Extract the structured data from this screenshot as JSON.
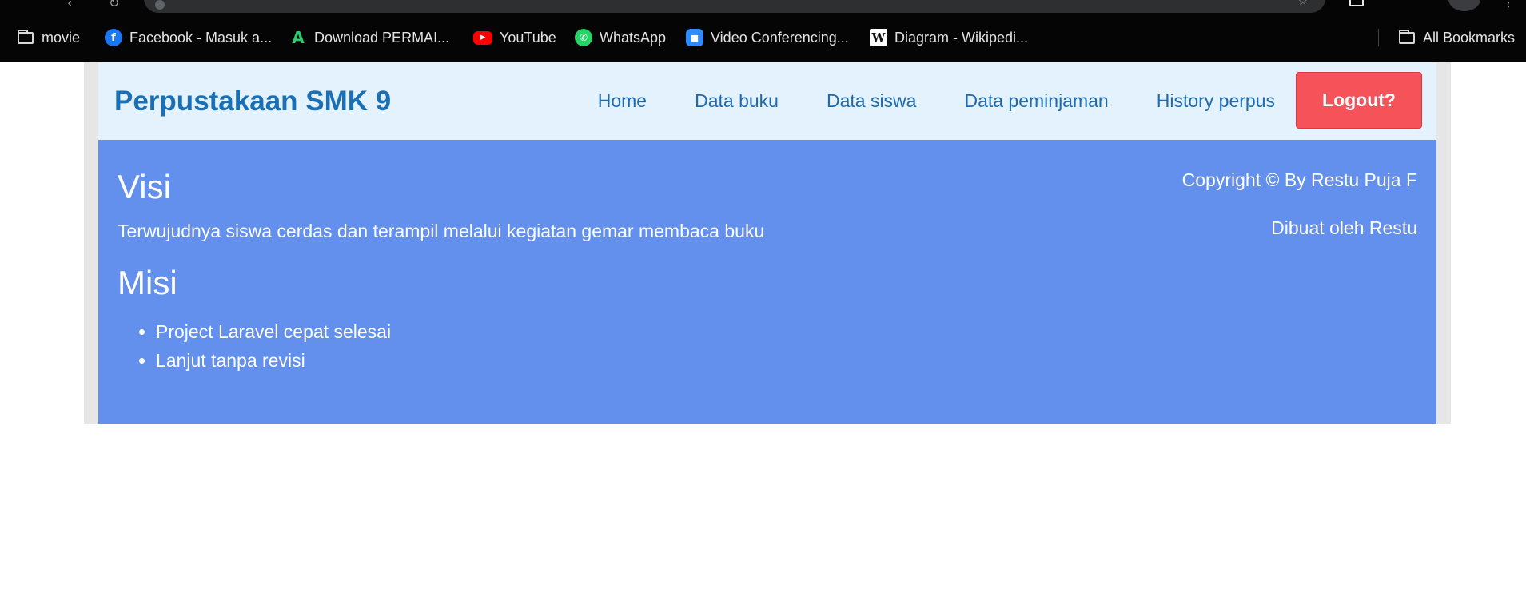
{
  "browser": {
    "bookmarks": [
      {
        "label": "movie",
        "icon": "folder-icon"
      },
      {
        "label": "Facebook - Masuk a...",
        "icon": "facebook-icon"
      },
      {
        "label": "Download PERMAI...",
        "icon": "apk-download-icon"
      },
      {
        "label": "YouTube",
        "icon": "youtube-icon"
      },
      {
        "label": "WhatsApp",
        "icon": "whatsapp-icon"
      },
      {
        "label": "Video Conferencing...",
        "icon": "zoom-icon"
      },
      {
        "label": "Diagram - Wikipedi...",
        "icon": "wikipedia-icon"
      }
    ],
    "all_bookmarks": "All Bookmarks"
  },
  "navbar": {
    "brand": "Perpustakaan SMK 9",
    "links": [
      "Home",
      "Data buku",
      "Data siswa",
      "Data peminjaman",
      "History perpus"
    ],
    "logout_label": "Logout?"
  },
  "content": {
    "visi_title": "Visi",
    "visi_text": "Terwujudnya siswa cerdas dan terampil melalui kegiatan gemar membaca buku",
    "misi_title": "Misi",
    "misi_items": [
      "Project Laravel cepat selesai",
      "Lanjut tanpa revisi"
    ],
    "copyright": "Copyright © By Restu Puja F",
    "credit": "Dibuat oleh Restu"
  },
  "colors": {
    "navbar_bg": "#e3f2fc",
    "brand": "#1a6fb5",
    "content_bg": "#6290ec",
    "logout_bg": "#f6525a"
  }
}
